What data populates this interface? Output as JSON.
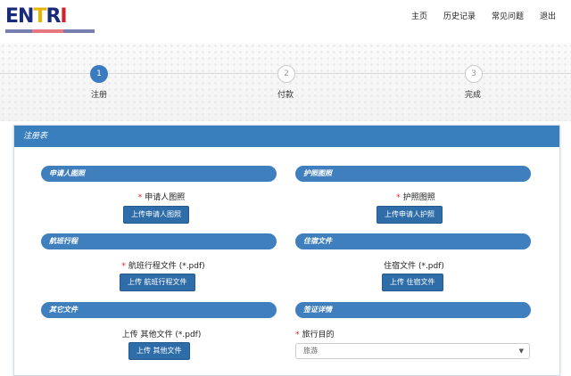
{
  "header": {
    "logo_text": [
      "EN",
      "T",
      "R",
      "I"
    ],
    "nav": [
      {
        "label": "主页"
      },
      {
        "label": "历史记录"
      },
      {
        "label": "常见问题"
      },
      {
        "label": "退出"
      }
    ]
  },
  "stepper": {
    "steps": [
      {
        "number": "1",
        "label": "注册",
        "active": true
      },
      {
        "number": "2",
        "label": "付款",
        "active": false
      },
      {
        "number": "3",
        "label": "完成",
        "active": false
      }
    ]
  },
  "panel": {
    "title": "注册表",
    "sections": {
      "applicant_photo": {
        "title": "申请人图照",
        "field_label": "申请人图照",
        "required": true,
        "button": "上传申请人图照"
      },
      "passport_photo": {
        "title": "护照图照",
        "field_label": "护照图照",
        "required": true,
        "button": "上传申请人护照"
      },
      "flight": {
        "title": "航班行程",
        "field_label": "航班行程文件 (*.pdf)",
        "required": true,
        "button": "上传 航班行程文件"
      },
      "accommodation": {
        "title": "住宿文件",
        "field_label": "住宿文件 (*.pdf)",
        "required": false,
        "button": "上传 住宿文件"
      },
      "other": {
        "title": "其它文件",
        "field_label": "上传 其他文件 (*.pdf)",
        "required": false,
        "button": "上传 其他文件"
      },
      "visa": {
        "title": "签证详情",
        "field_label": "旅行目的",
        "required": true,
        "select_value": "旅游"
      }
    }
  },
  "colors": {
    "primary": "#3a7fbd",
    "button": "#2e6da8",
    "required": "#d9232d"
  }
}
